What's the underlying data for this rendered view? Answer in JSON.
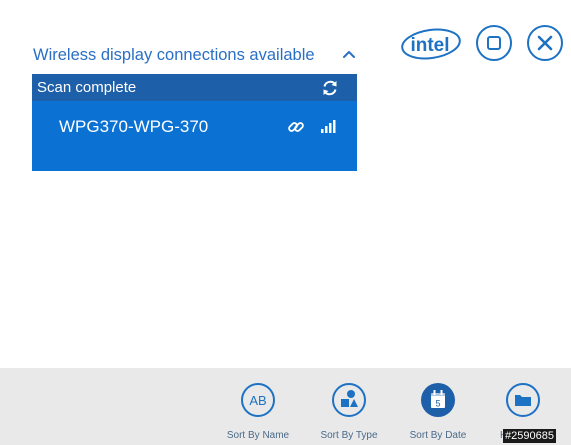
{
  "header": {
    "panel_title": "Wireless display connections available"
  },
  "brand": {
    "logo_text": "intel"
  },
  "scan": {
    "status": "Scan complete"
  },
  "devices": [
    {
      "name": "WPG370-WPG-370"
    }
  ],
  "toolbar": {
    "sort_name_label": "Sort By Name",
    "sort_name_icon_text": "AB",
    "sort_type_label": "Sort By Type",
    "sort_date_label": "Sort By Date",
    "sort_date_icon_text": "5",
    "home_label": "H"
  },
  "watermark": "#2590685",
  "colors": {
    "accent": "#1d72c4",
    "panel": "#0b72d4",
    "panel_header": "#1d5fa8",
    "toolbar_bg": "#e9e9e9"
  },
  "icons": {
    "collapse": "chevron-up-icon",
    "restore": "square-icon",
    "close": "close-icon",
    "refresh": "refresh-icon",
    "connect": "link-icon",
    "signal": "signal-bars-icon",
    "sort_name": "ab-icon",
    "sort_type": "shapes-icon",
    "sort_date": "calendar-icon",
    "home": "folder-icon"
  }
}
